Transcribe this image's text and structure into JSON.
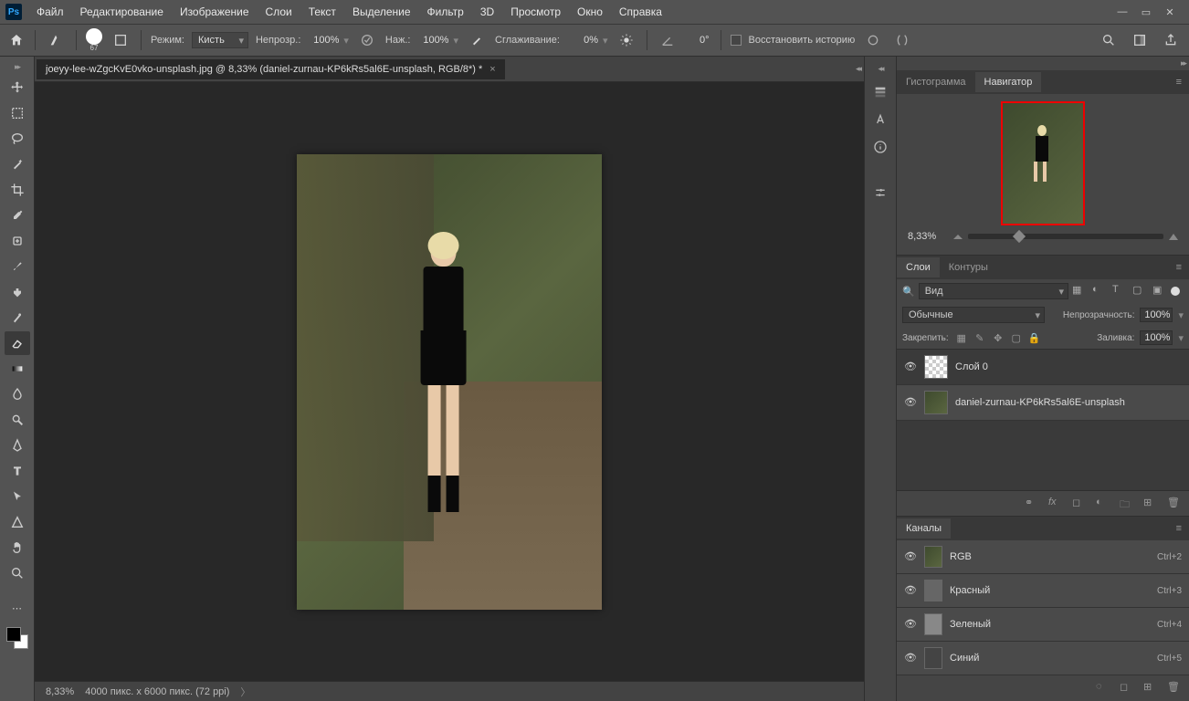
{
  "menu": {
    "items": [
      "Файл",
      "Редактирование",
      "Изображение",
      "Слои",
      "Текст",
      "Выделение",
      "Фильтр",
      "3D",
      "Просмотр",
      "Окно",
      "Справка"
    ]
  },
  "optbar": {
    "brush_size": "67",
    "mode_label": "Режим:",
    "mode_value": "Кисть",
    "opacity_label": "Непрозр.:",
    "opacity_value": "100%",
    "flow_label": "Наж.:",
    "flow_value": "100%",
    "smoothing_label": "Сглаживание:",
    "smoothing_value": "0%",
    "angle_value": "0°",
    "restore_label": "Восстановить историю"
  },
  "document": {
    "tab_title": "joeyy-lee-wZgcKvE0vko-unsplash.jpg @ 8,33% (daniel-zurnau-KP6kRs5al6E-unsplash, RGB/8*) *",
    "zoom": "8,33%",
    "status": "4000 пикс. x 6000 пикс. (72 ppi)"
  },
  "navigator": {
    "tab_histogram": "Гистограмма",
    "tab_navigator": "Навигатор",
    "zoom": "8,33%"
  },
  "layers": {
    "tab_layers": "Слои",
    "tab_paths": "Контуры",
    "filter": "Вид",
    "blend_mode": "Обычные",
    "opacity_label": "Непрозрачность:",
    "opacity_value": "100%",
    "lock_label": "Закрепить:",
    "fill_label": "Заливка:",
    "fill_value": "100%",
    "items": [
      {
        "name": "Слой 0"
      },
      {
        "name": "daniel-zurnau-KP6kRs5al6E-unsplash"
      }
    ]
  },
  "channels": {
    "tab": "Каналы",
    "items": [
      {
        "name": "RGB",
        "shortcut": "Ctrl+2"
      },
      {
        "name": "Красный",
        "shortcut": "Ctrl+3"
      },
      {
        "name": "Зеленый",
        "shortcut": "Ctrl+4"
      },
      {
        "name": "Синий",
        "shortcut": "Ctrl+5"
      }
    ]
  }
}
